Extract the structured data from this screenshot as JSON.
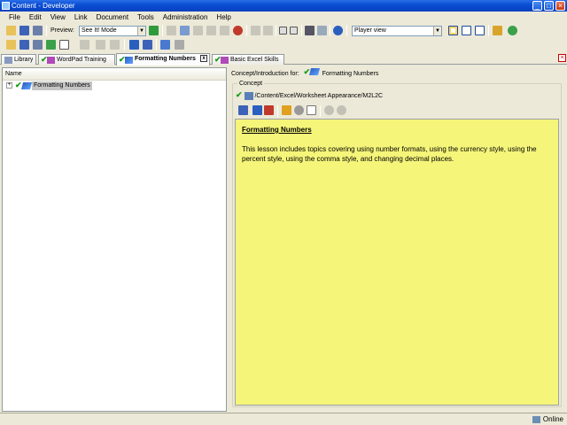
{
  "window": {
    "title": "Content - Developer"
  },
  "menu": [
    "File",
    "Edit",
    "View",
    "Link",
    "Document",
    "Tools",
    "Administration",
    "Help"
  ],
  "toolbar": {
    "preview_label": "Preview:",
    "preview_mode": "See It! Mode",
    "player_view": "Player view"
  },
  "tabs": [
    {
      "label": "Library",
      "active": false,
      "closable": false
    },
    {
      "label": "WordPad Training",
      "active": false,
      "closable": false
    },
    {
      "label": "Formatting Numbers",
      "active": true,
      "closable": true
    },
    {
      "label": "Basic Excel Skills",
      "active": false,
      "closable": false
    }
  ],
  "left_pane": {
    "column_header": "Name",
    "tree": [
      {
        "label": "Formatting Numbers",
        "expander": "+",
        "checked": true
      }
    ]
  },
  "right_pane": {
    "header_prefix": "Concept/Introduction for:",
    "header_item": "Formatting Numbers",
    "group_label": "Concept",
    "path": "/Content/Excel/Worksheet Appearance/M2L2C",
    "content": {
      "heading": "Formatting Numbers",
      "body": "This lesson includes topics covering using number formats, using the currency style, using the percent style, using the comma style, and changing decimal places."
    }
  },
  "status": {
    "text": "Online"
  },
  "colors": {
    "content_background": "#f5f57a",
    "titlebar": "#0a4fd4",
    "check": "#1a9c1a"
  }
}
